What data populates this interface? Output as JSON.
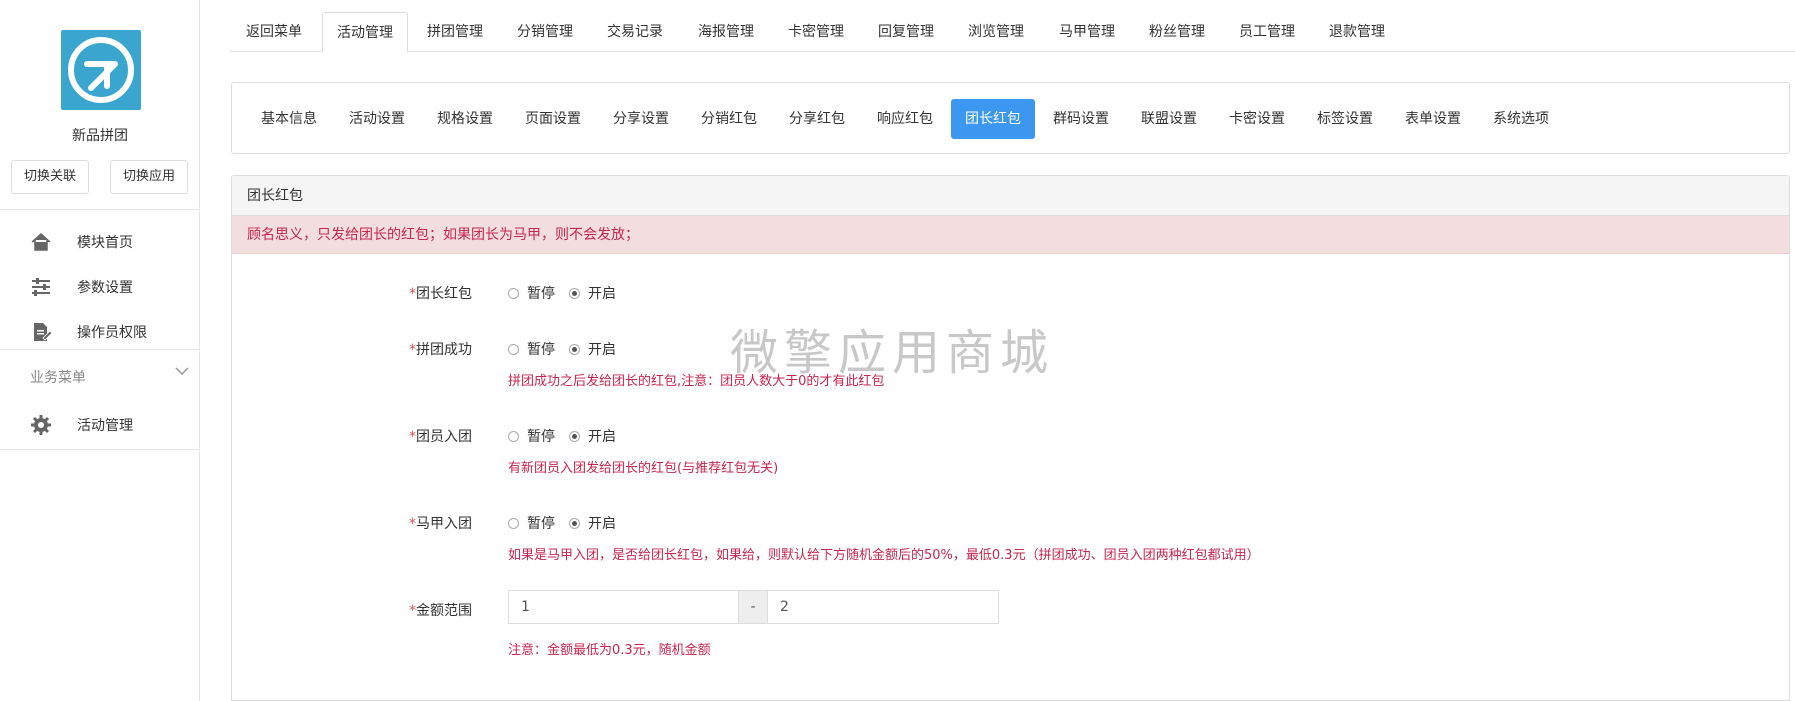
{
  "sidebar": {
    "app_name": "新品拼团",
    "switch_link_label": "切换关联",
    "switch_app_label": "切换应用",
    "menu": [
      {
        "label": "模块首页",
        "icon": "home-icon"
      },
      {
        "label": "参数设置",
        "icon": "sliders-icon"
      },
      {
        "label": "操作员权限",
        "icon": "document-edit-icon"
      }
    ],
    "group_title": "业务菜单",
    "group_items": [
      {
        "label": "活动管理",
        "icon": "gear-icon"
      }
    ]
  },
  "top_tabs": [
    "返回菜单",
    "活动管理",
    "拼团管理",
    "分销管理",
    "交易记录",
    "海报管理",
    "卡密管理",
    "回复管理",
    "浏览管理",
    "马甲管理",
    "粉丝管理",
    "员工管理",
    "退款管理"
  ],
  "top_tabs_active": "活动管理",
  "sub_tabs": [
    "基本信息",
    "活动设置",
    "规格设置",
    "页面设置",
    "分享设置",
    "分销红包",
    "分享红包",
    "响应红包",
    "团长红包",
    "群码设置",
    "联盟设置",
    "卡密设置",
    "标签设置",
    "表单设置",
    "系统选项"
  ],
  "sub_tabs_active": "团长红包",
  "panel": {
    "title": "团长红包",
    "notice": "顾名思义，只发给团长的红包；如果团长为马甲，则不会发放；",
    "radio_off": "暂停",
    "radio_on": "开启",
    "fields": [
      {
        "label": "团长红包",
        "value": "开启",
        "hint": ""
      },
      {
        "label": "拼团成功",
        "value": "开启",
        "hint": "拼团成功之后发给团长的红包,注意：团员人数大于0的才有此红包"
      },
      {
        "label": "团员入团",
        "value": "开启",
        "hint": "有新团员入团发给团长的红包(与推荐红包无关)"
      },
      {
        "label": "马甲入团",
        "value": "开启",
        "hint": "如果是马甲入团，是否给团长红包，如果给，则默认给下方随机金额后的50%，最低0.3元（拼团成功、团员入团两种红包都试用）"
      }
    ],
    "amount": {
      "label": "金额范围",
      "min": "1",
      "sep": "-",
      "max": "2",
      "hint": "注意：金额最低为0.3元，随机金额"
    }
  },
  "watermark": "微擎应用商城",
  "colors": {
    "accent": "#3c97f0",
    "logo_bg": "#3aa6cf",
    "notice_bg": "#f2dede",
    "notice_text": "#c7254e"
  }
}
